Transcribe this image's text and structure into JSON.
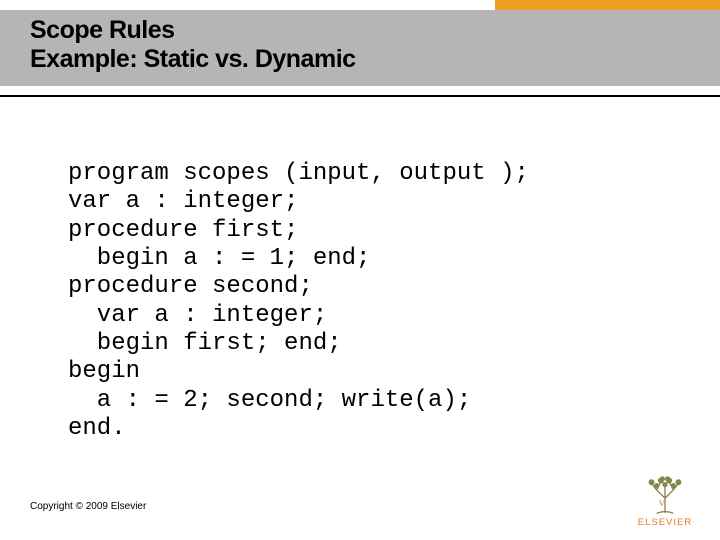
{
  "title": {
    "line1": "Scope Rules",
    "line2": "Example: Static vs. Dynamic"
  },
  "code": "program scopes (input, output );\nvar a : integer;\nprocedure first;\n  begin a : = 1; end;\nprocedure second;\n  var a : integer;\n  begin first; end;\nbegin\n  a : = 2; second; write(a);\nend.",
  "footer": {
    "copyright": "Copyright © 2009 Elsevier",
    "publisher": "ELSEVIER"
  },
  "colors": {
    "accent": "#f0a020",
    "band": "#b5b5b5",
    "logo_orange": "#e77a1e"
  }
}
